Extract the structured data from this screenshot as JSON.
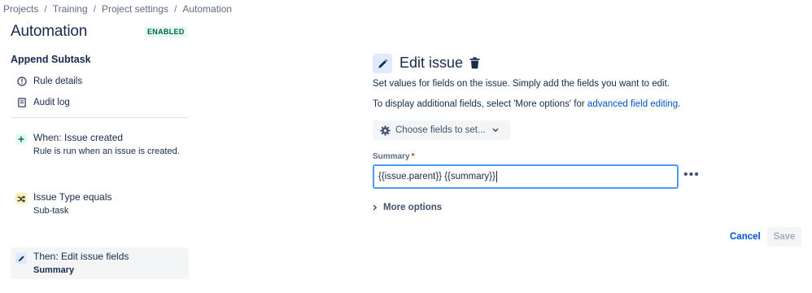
{
  "breadcrumb": [
    "Projects",
    "Training",
    "Project settings",
    "Automation"
  ],
  "header": {
    "title": "Automation",
    "status": "ENABLED",
    "status_color": "#006644",
    "status_bg": "#e3fcef"
  },
  "rule": {
    "name": "Append Subtask",
    "links": [
      {
        "label": "Rule details",
        "icon": "info-icon"
      },
      {
        "label": "Audit log",
        "icon": "clipboard-icon"
      }
    ],
    "steps": [
      {
        "title": "When: Issue created",
        "subtitle": "Rule is run when an issue is created.",
        "icon": "plus-icon",
        "color": "#e3fcef"
      },
      {
        "title": "Issue Type equals",
        "subtitle": "Sub-task",
        "icon": "shuffle-icon",
        "color": "#fff0b3"
      },
      {
        "title": "Then: Edit issue fields",
        "subtitle": "Summary",
        "icon": "pencil-icon",
        "color": "#deebff",
        "selected": true
      }
    ]
  },
  "panel": {
    "title": "Edit issue",
    "description": "Set values for fields on the issue. Simply add the fields you want to edit.",
    "hint_prefix": "To display additional fields, select 'More options' for ",
    "hint_link": "advanced field editing",
    "hint_suffix": ".",
    "choose_fields_label": "Choose fields to set...",
    "field_label": "Summary",
    "field_required": "*",
    "field_value": "{{issue.parent}} {{summary}}",
    "more_options_label": "More options",
    "cancel_label": "Cancel",
    "save_label": "Save"
  },
  "colors": {
    "accent": "#0052cc",
    "focus_border": "#4c9aff",
    "required": "#de350b"
  }
}
